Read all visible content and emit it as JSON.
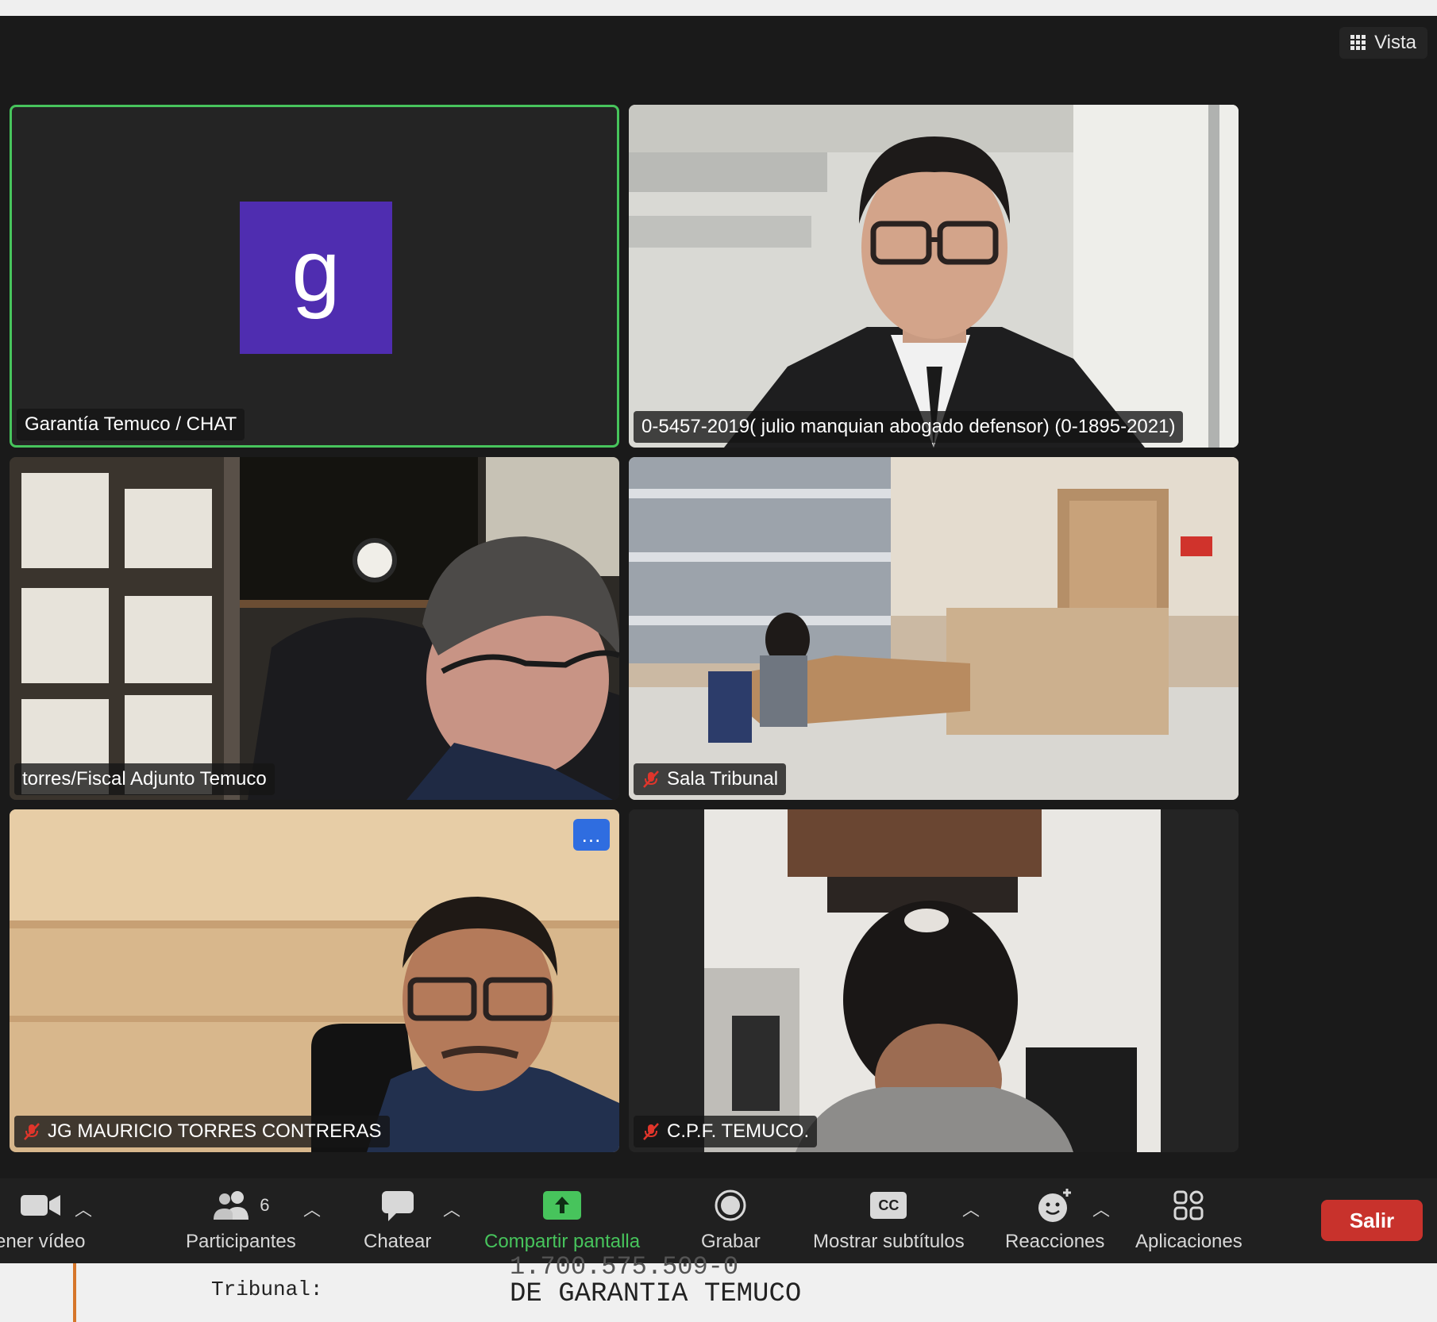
{
  "header": {
    "view_label": "Vista"
  },
  "tiles": [
    {
      "name": "Garantía Temuco / CHAT",
      "avatar_letter": "g",
      "muted": false,
      "active_speaker": true
    },
    {
      "name": "0-5457-2019( julio manquian abogado defensor) (0-1895-2021)",
      "muted": false
    },
    {
      "name": "torres/Fiscal Adjunto Temuco",
      "muted": false
    },
    {
      "name": "Sala Tribunal",
      "muted": true
    },
    {
      "name": "JG MAURICIO TORRES CONTRERAS",
      "muted": true,
      "more_button": "..."
    },
    {
      "name": "C.P.F. TEMUCO.",
      "muted": true
    }
  ],
  "toolbar": {
    "video_label": "ener vídeo",
    "participants_label": "Participantes",
    "participants_count": "6",
    "chat_label": "Chatear",
    "share_label": "Compartir pantalla",
    "record_label": "Grabar",
    "captions_label": "Mostrar subtítulos",
    "captions_icon_text": "CC",
    "reactions_label": "Reacciones",
    "apps_label": "Aplicaciones",
    "leave_label": "Salir"
  },
  "document": {
    "field_label": "Tribunal:",
    "case_number_partial": "1.700.575.509-0",
    "court_value": "DE GARANTIA TEMUCO"
  },
  "colors": {
    "active_border": "#47c45c",
    "avatar_bg": "#4f2db0",
    "share_green": "#47c45c",
    "leave_red": "#c8322c",
    "mute_red": "#e0352b"
  }
}
